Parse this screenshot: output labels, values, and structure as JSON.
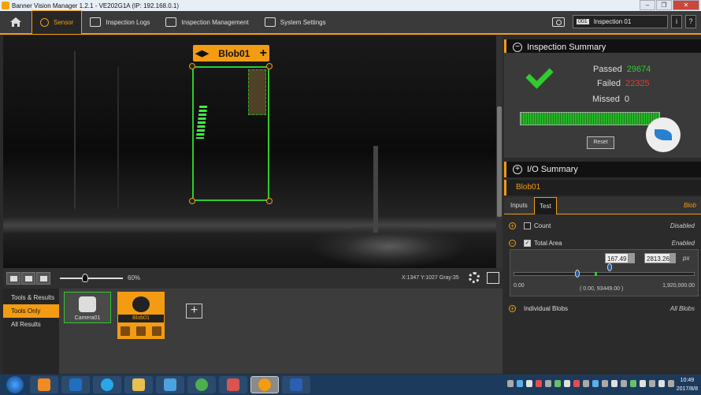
{
  "window": {
    "title": "Banner Vision Manager 1.2.1 - VE202G1A (IP: 192.168.0.1)",
    "controls": [
      "–",
      "❐",
      "✕"
    ]
  },
  "menu": {
    "items": [
      {
        "label": "Sensor",
        "icon": "magnifier-icon",
        "active": true
      },
      {
        "label": "Inspection Logs",
        "icon": "books-icon"
      },
      {
        "label": "Inspection Management",
        "icon": "list-icon"
      },
      {
        "label": "System Settings",
        "icon": "wrench-icon"
      }
    ],
    "inspection_number": "001",
    "inspection_name": "Inspection 01",
    "info_btn": "i",
    "help_btn": "?"
  },
  "viewport": {
    "blob_tool_label": "Blob01",
    "tag_arrows": "◀▶",
    "tag_plus": "+"
  },
  "viewbar": {
    "zoom": "60%",
    "coords": "X:1347 Y:1027 Gray:35"
  },
  "tools_panel": {
    "filters": [
      "Tools & Results",
      "Tools Only",
      "All Results"
    ],
    "active_filter": "Tools Only",
    "tools": [
      {
        "label": "Camera01"
      },
      {
        "label": "Blob01",
        "selected": true
      }
    ],
    "add": "+"
  },
  "inspection_summary": {
    "title": "Inspection Summary",
    "passed_label": "Passed",
    "passed_value": "29674",
    "failed_label": "Failed",
    "failed_value": "22325",
    "missed_label": "Missed",
    "missed_value": "0",
    "reset_label": "Reset",
    "toggle": "−"
  },
  "io_summary": {
    "title": "I/O Summary",
    "toggle": "+"
  },
  "tool_detail": {
    "title": "Blob01",
    "tabs": [
      "Inputs",
      "Test"
    ],
    "active_tab": "Test",
    "tool_type": "Blob",
    "tests": [
      {
        "label": "Count",
        "status": "Disabled",
        "checked": false,
        "expand": "+"
      },
      {
        "label": "Total Area",
        "status": "Enabled",
        "checked": true,
        "expand": "−"
      },
      {
        "label": "Individual Blobs",
        "status": "All Blobs",
        "expand": "+"
      }
    ],
    "total_area": {
      "min_input": "167.49",
      "max_input": "2813.26",
      "unit": "px",
      "range_min": "0.00",
      "range_max": "1,920,000.00",
      "current": "( 0.00, 93449.00 )"
    }
  },
  "taskbar": {
    "time": "10:49",
    "date": "2017/8/8"
  },
  "colors": {
    "accent": "#f39c12",
    "pass": "#2ecc2e",
    "fail": "#e03c3c"
  }
}
